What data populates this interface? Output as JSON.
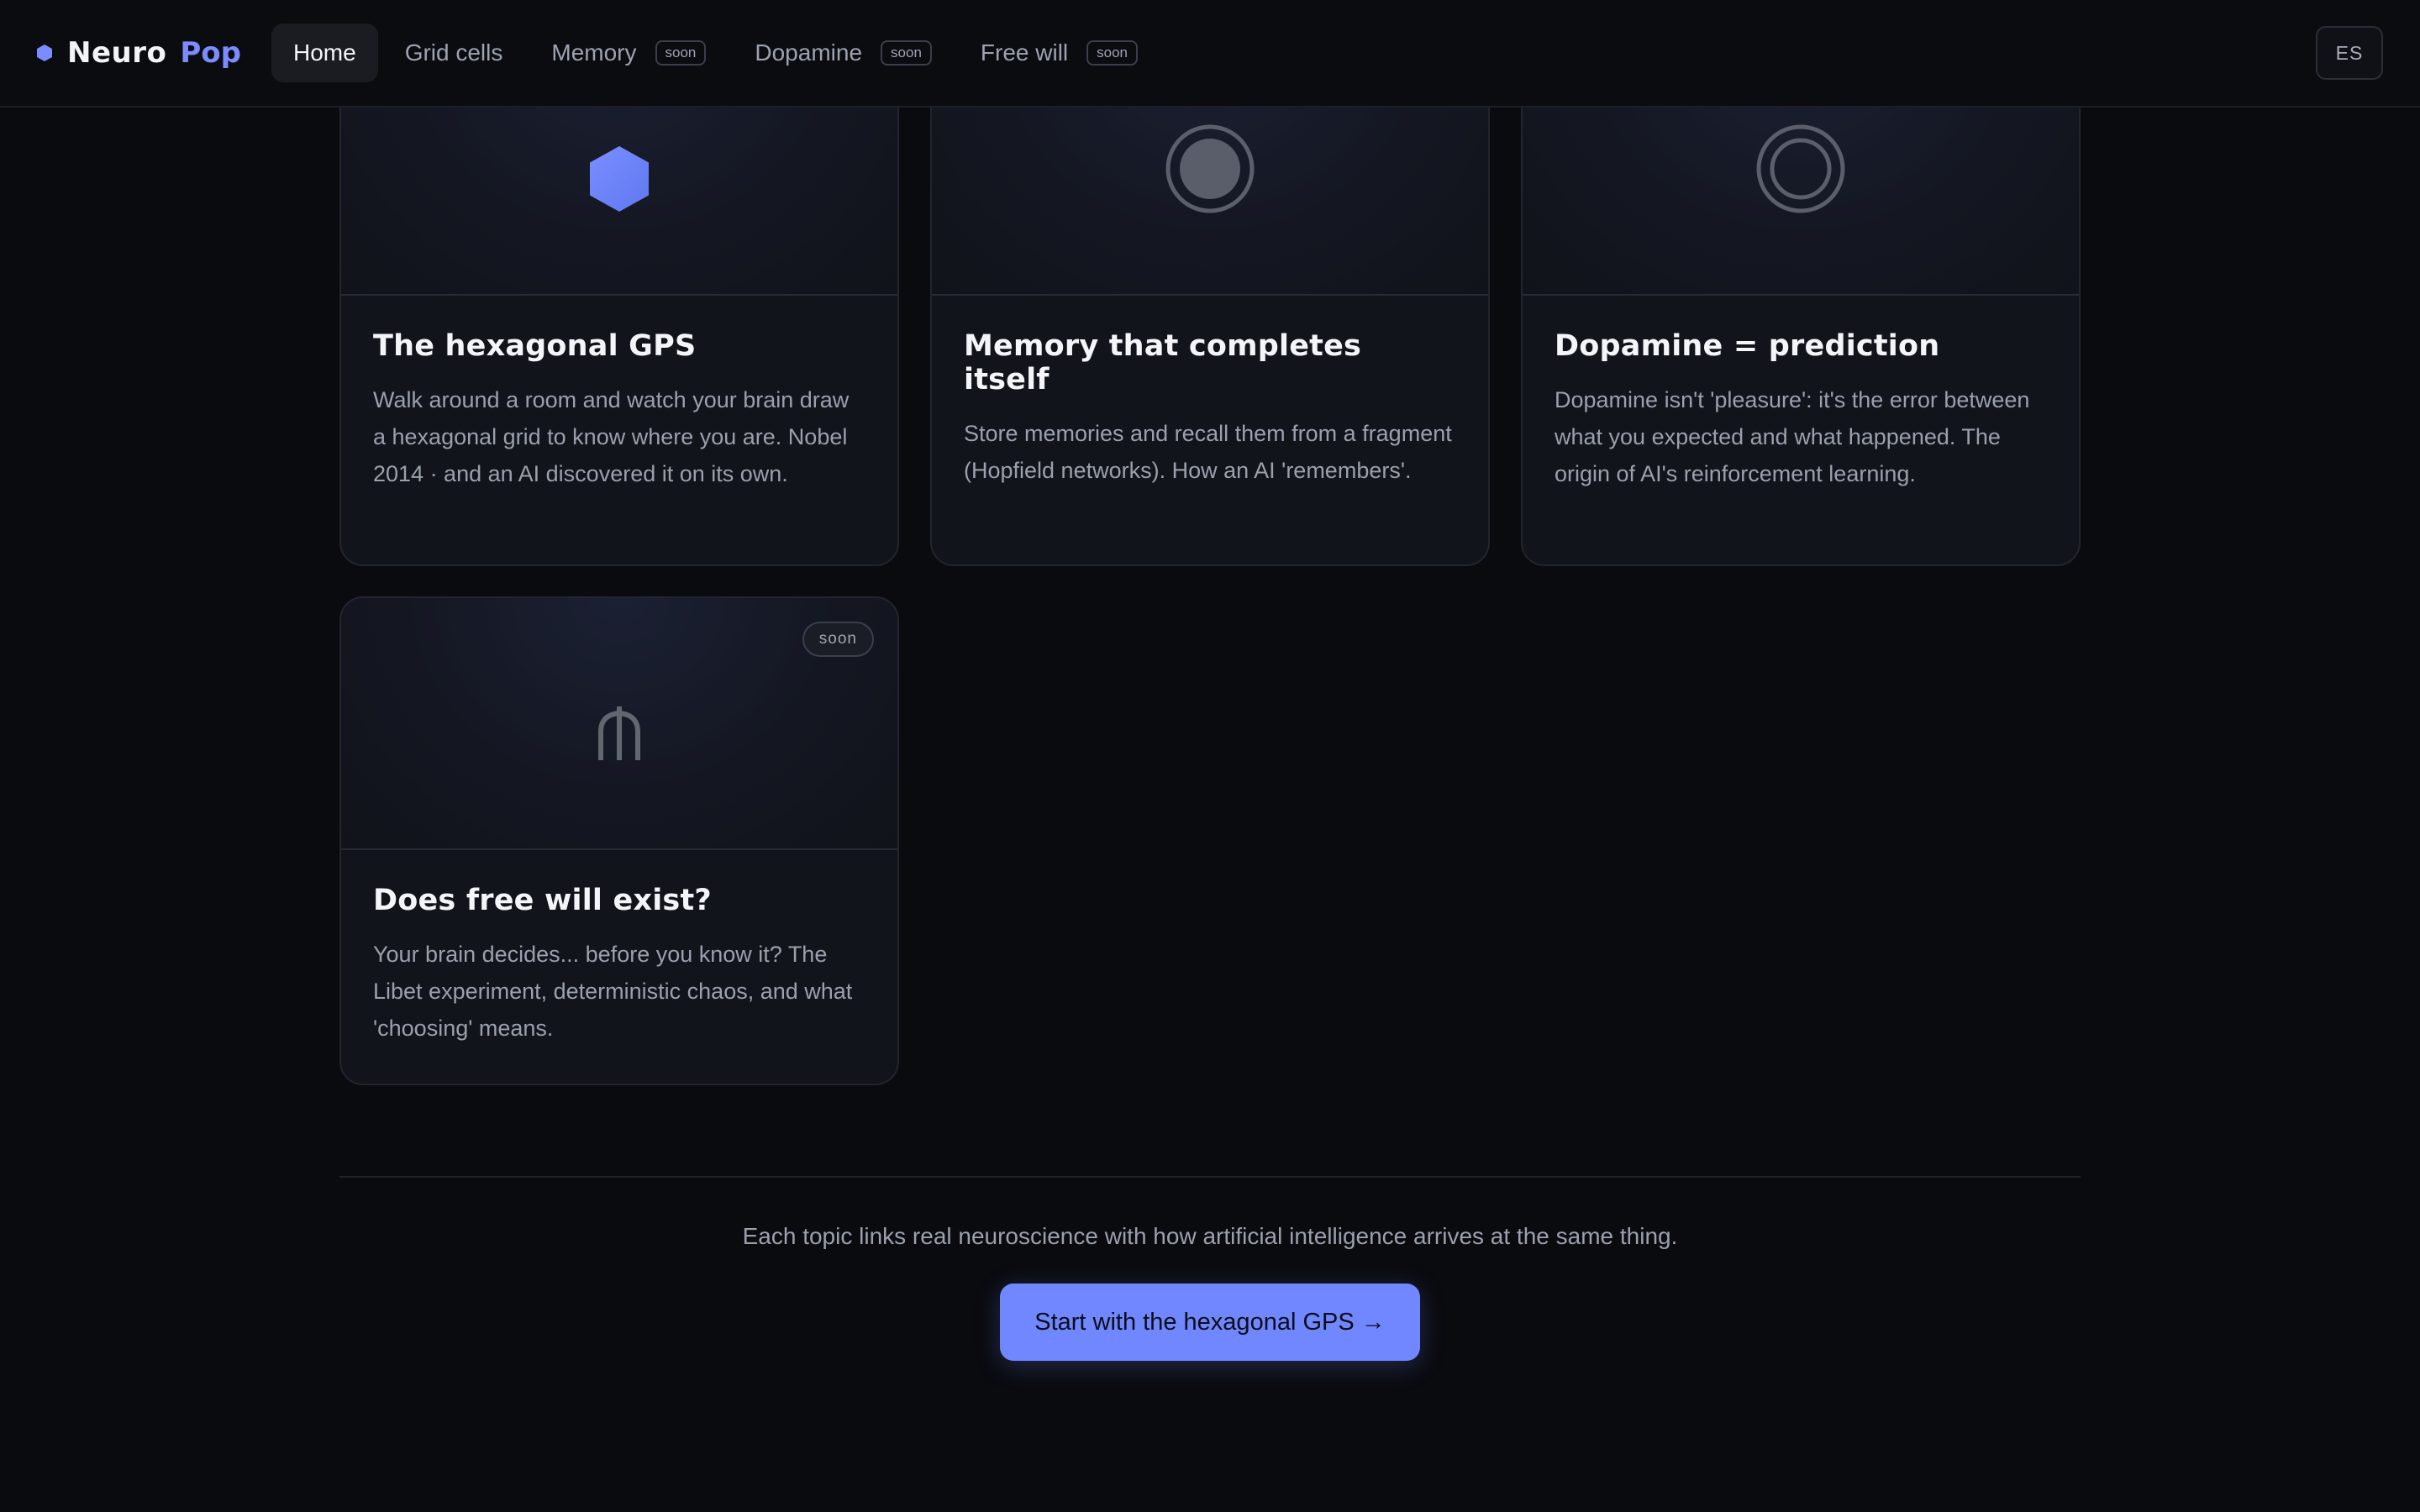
{
  "brand": {
    "word1": "Neuro",
    "word2": "Pop",
    "accent": "#7b8cff"
  },
  "nav": {
    "items": [
      {
        "label": "Home",
        "badge": "",
        "active": true
      },
      {
        "label": "Grid cells",
        "badge": ""
      },
      {
        "label": "Memory",
        "badge": "soon"
      },
      {
        "label": "Dopamine",
        "badge": "soon"
      },
      {
        "label": "Free will",
        "badge": "soon"
      }
    ],
    "lang": "ES"
  },
  "cards": [
    {
      "icon": "hexagon-icon",
      "title": "The hexagonal GPS",
      "desc": "Walk around a room and watch your brain draw a hexagonal grid to know where you are. Nobel 2014 · and an AI discovered it on its own."
    },
    {
      "icon": "filled-circle-icon",
      "title": "Memory that completes itself",
      "desc": "Store memories and recall them from a fragment (Hopfield networks). How an AI 'remembers'."
    },
    {
      "icon": "ring-icon",
      "title": "Dopamine = prediction",
      "desc": "Dopamine isn't 'pleasure': it's the error between what you expected and what happened. The origin of AI's reinforcement learning."
    },
    {
      "icon": "fork-icon",
      "title": "Does free will exist?",
      "desc": "Your brain decides... before you know it? The Libet experiment, deterministic chaos, and what 'choosing' means.",
      "badge": "soon"
    }
  ],
  "footer": {
    "tagline": "Each topic links real neuroscience with how artificial intelligence arrives at the same thing.",
    "cta": "Start with the hexagonal GPS →"
  }
}
